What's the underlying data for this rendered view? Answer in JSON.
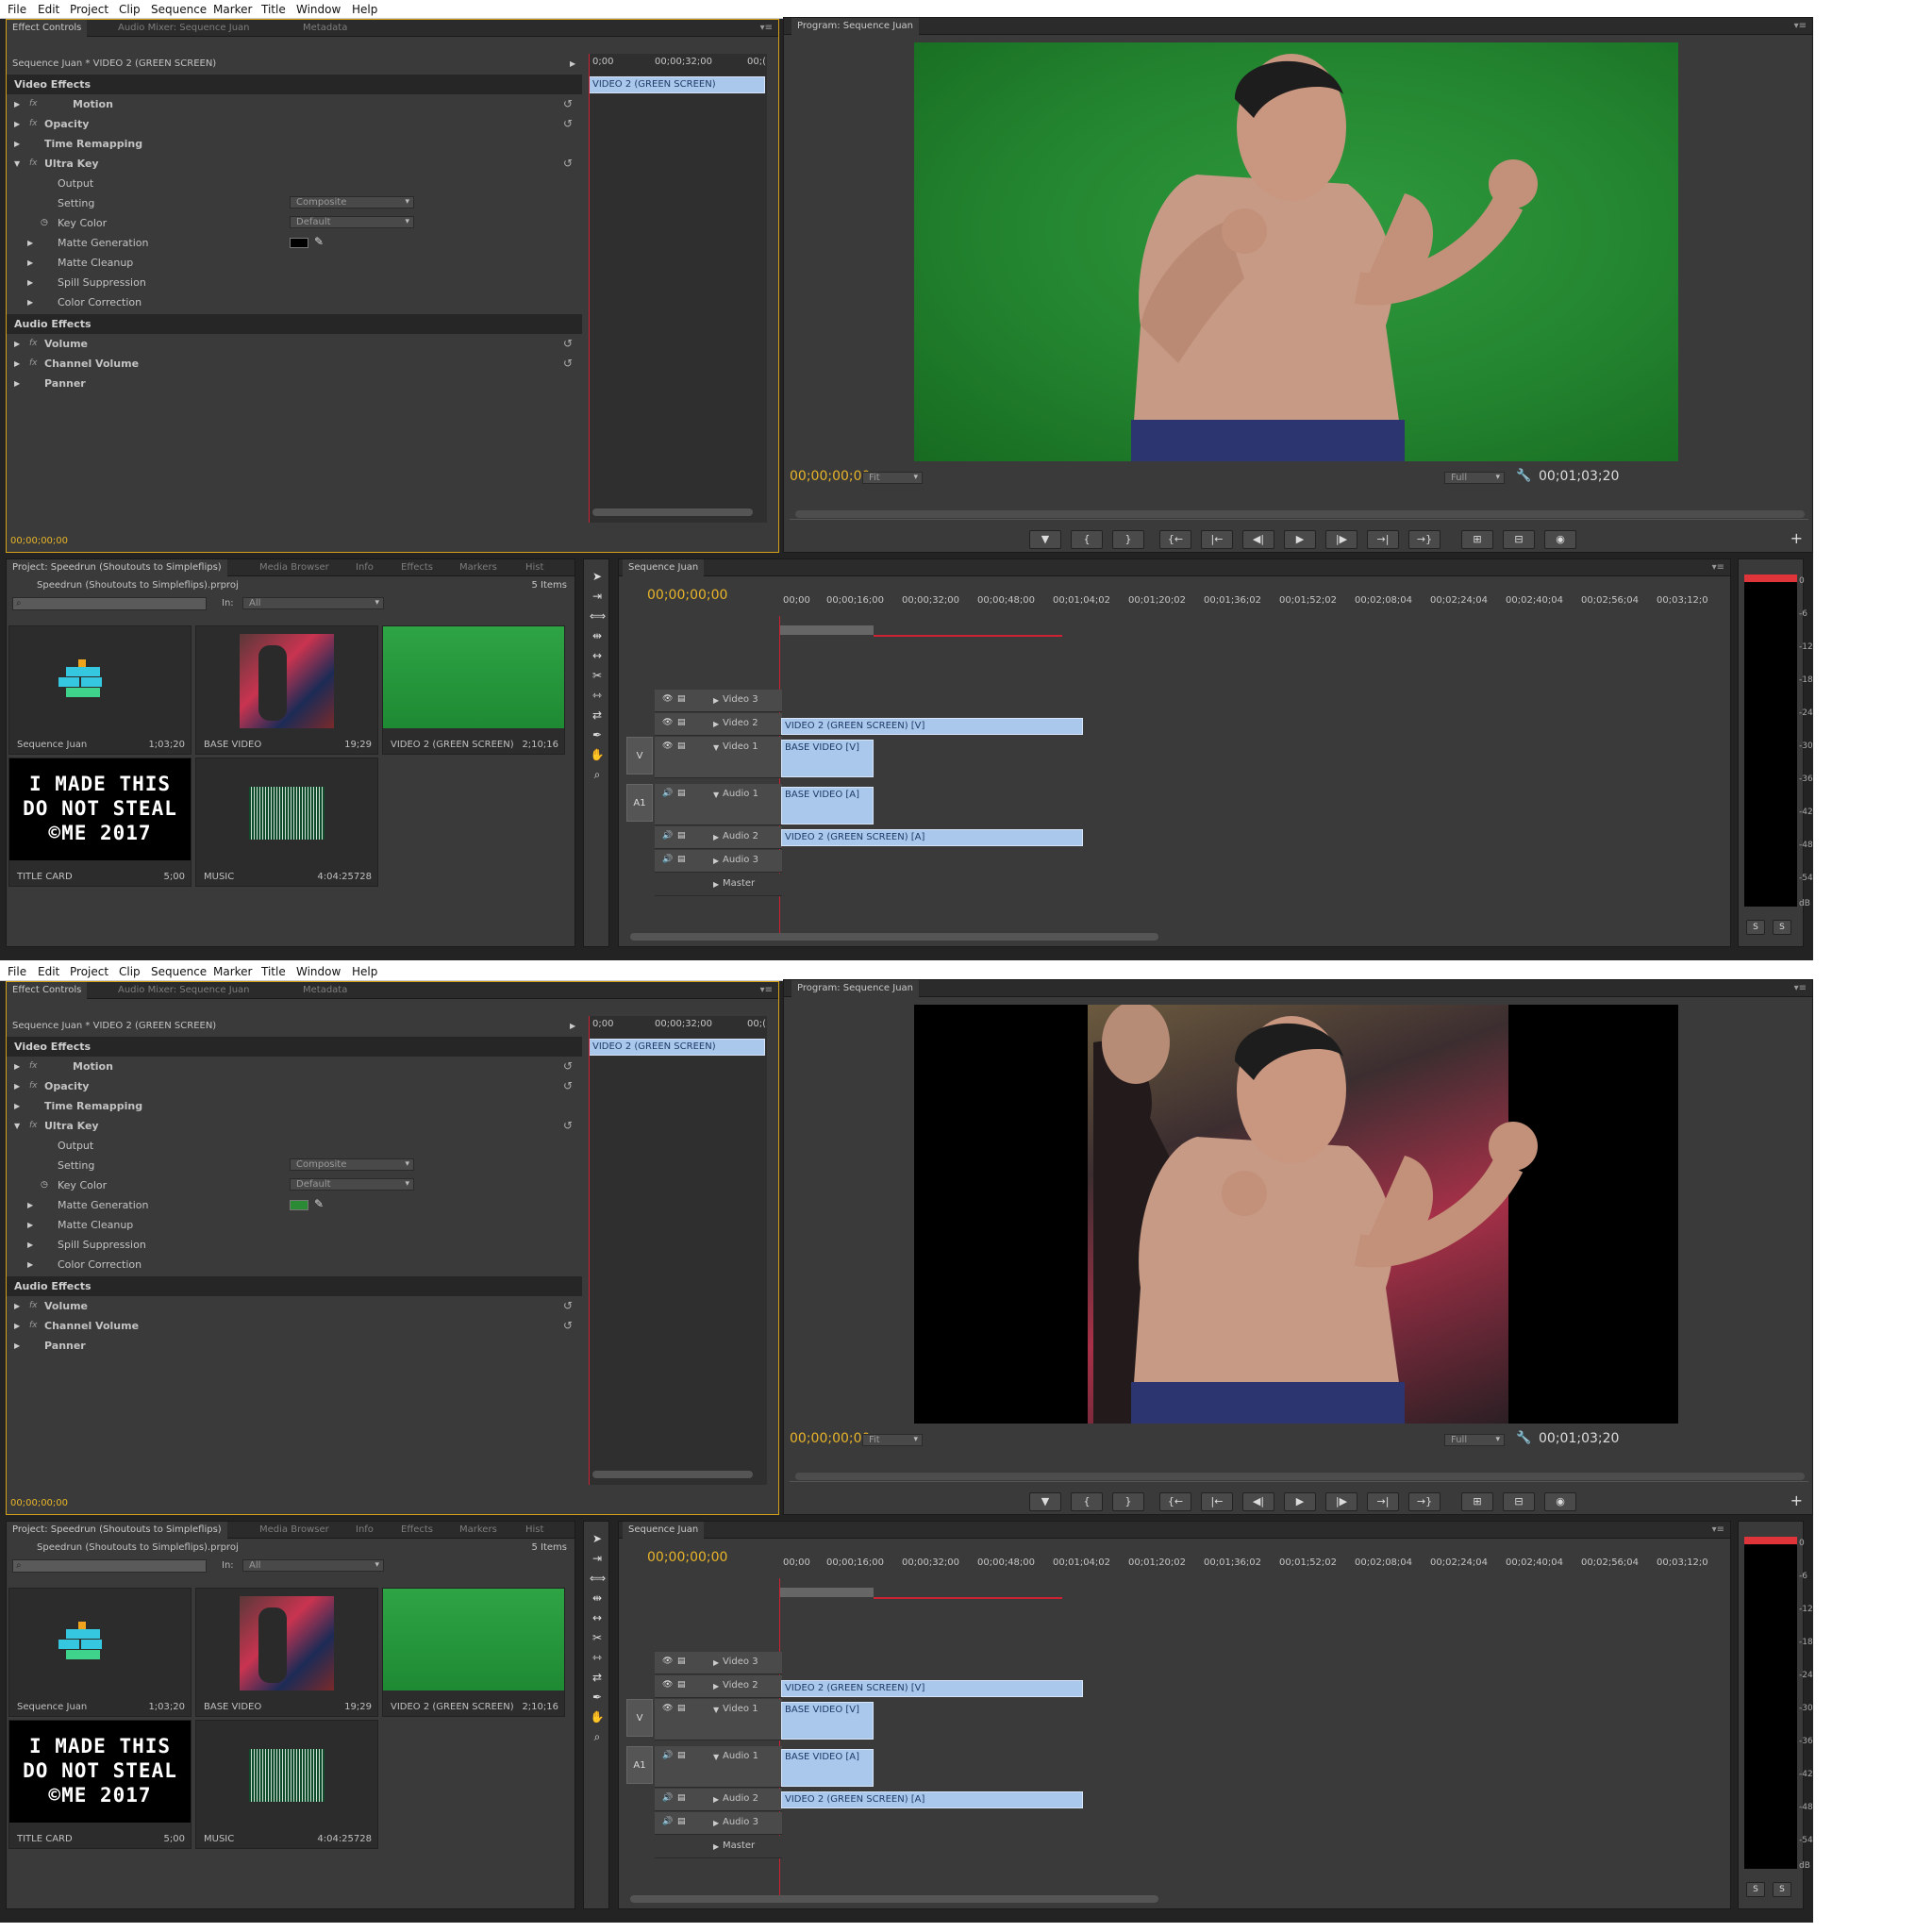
{
  "menu": [
    "File",
    "Edit",
    "Project",
    "Clip",
    "Sequence",
    "Marker",
    "Title",
    "Window",
    "Help"
  ],
  "effect_controls": {
    "tabs": [
      "Effect Controls",
      "Audio Mixer: Sequence Juan",
      "Metadata"
    ],
    "source_label": "Sequence Juan * VIDEO 2 (GREEN SCREEN)",
    "ruler": [
      "0;00",
      "00;00;32;00",
      "00;("
    ],
    "clip_label": "VIDEO 2 (GREEN SCREEN)",
    "video_effects": "Video Effects",
    "motion": "Motion",
    "opacity": "Opacity",
    "time_remapping": "Time Remapping",
    "ultra_key": "Ultra Key",
    "output_label": "Output",
    "output_value": "Composite",
    "setting_label": "Setting",
    "setting_value": "Default",
    "key_color_label": "Key Color",
    "matte_generation": "Matte Generation",
    "matte_cleanup": "Matte Cleanup",
    "spill_suppression": "Spill Suppression",
    "color_correction": "Color Correction",
    "audio_effects": "Audio Effects",
    "volume": "Volume",
    "channel_volume": "Channel Volume",
    "panner": "Panner",
    "timecode": "00;00;00;00"
  },
  "program_monitor": {
    "title": "Program: Sequence Juan",
    "timecode_left": "00;00;00;00",
    "fit": "Fit",
    "full": "Full",
    "timecode_right": "00;01;03;20",
    "buttons": [
      "▼",
      "{",
      "}",
      "{←",
      "|←",
      "◀|",
      "▶",
      "|▶",
      "→|",
      "→}",
      "⊞",
      "⊟",
      "◉"
    ]
  },
  "project": {
    "tabs": [
      "Project: Speedrun (Shoutouts to Simpleflips)",
      "Media Browser",
      "Info",
      "Effects",
      "Markers",
      "Hist"
    ],
    "file": "Speedrun (Shoutouts to Simpleflips).prproj",
    "count": "5 Items",
    "in_label": "In:",
    "in_value": "All",
    "items": [
      {
        "name": "Sequence Juan",
        "dur": "1;03;20"
      },
      {
        "name": "BASE VIDEO",
        "dur": "19;29"
      },
      {
        "name": "VIDEO 2 (GREEN SCREEN)",
        "dur": "2;10;16"
      },
      {
        "name": "TITLE CARD",
        "dur": "5;00"
      },
      {
        "name": "MUSIC",
        "dur": "4:04:25728"
      }
    ],
    "title_card_text": [
      "I MADE THIS",
      "DO NOT STEAL",
      "©ME 2017"
    ]
  },
  "timeline": {
    "tab": "Sequence Juan",
    "timecode": "00;00;00;00",
    "ruler": [
      "00;00",
      "00;00;16;00",
      "00;00;32;00",
      "00;00;48;00",
      "00;01;04;02",
      "00;01;20;02",
      "00;01;36;02",
      "00;01;52;02",
      "00;02;08;04",
      "00;02;24;04",
      "00;02;40;04",
      "00;02;56;04",
      "00;03;12;0"
    ],
    "v_label": "V",
    "a_label": "A1",
    "tracks": {
      "video3": "Video 3",
      "video2": "Video 2",
      "video1": "Video 1",
      "audio1": "Audio 1",
      "audio2": "Audio 2",
      "audio3": "Audio 3",
      "master": "Master"
    },
    "clips": {
      "v2": "VIDEO 2 (GREEN SCREEN) [V]",
      "v1": "BASE VIDEO [V]",
      "a1": "BASE VIDEO [A]",
      "a2": "VIDEO 2 (GREEN SCREEN) [A]"
    }
  },
  "meters": {
    "db_labels": [
      "0",
      "-6",
      "-12",
      "-18",
      "-24",
      "-30",
      "-36",
      "-42",
      "-48",
      "-54",
      "dB"
    ],
    "solo": "S"
  },
  "states": [
    {
      "name": "before",
      "key_color": "#000000",
      "program_view": "green-screen"
    },
    {
      "name": "after",
      "key_color": "#2b8a34",
      "program_view": "composite"
    }
  ],
  "colors": {
    "accent_timecode": "#e8b429",
    "clip_blue": "#a9c8ec",
    "green_screen": "#23842f",
    "playhead": "#cc2233"
  }
}
